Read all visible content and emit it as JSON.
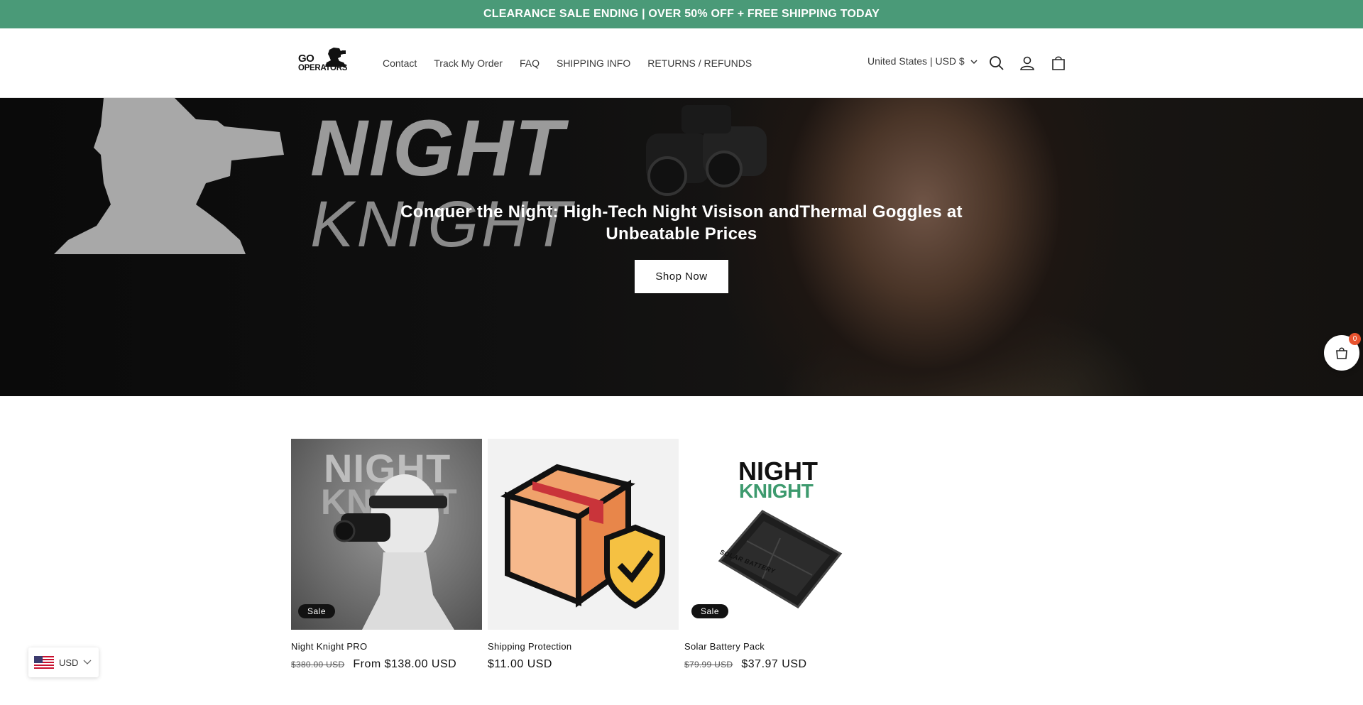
{
  "announcement": {
    "text": "CLEARANCE SALE ENDING | OVER 50% OFF + FREE SHIPPING TODAY"
  },
  "header": {
    "logo": {
      "line1": "GO",
      "line2": "OPERATORS"
    },
    "nav": [
      {
        "label": "Contact"
      },
      {
        "label": "Track My Order"
      },
      {
        "label": "FAQ"
      },
      {
        "label": "SHIPPING INFO"
      },
      {
        "label": "RETURNS / REFUNDS"
      }
    ],
    "region": "United States | USD $",
    "icons": [
      "search-icon",
      "account-icon",
      "cart-icon"
    ]
  },
  "hero": {
    "background_words": {
      "line1": "NIGHT",
      "line2": "KNIGHT"
    },
    "title": "Conquer the Night: High-Tech Night Visison andThermal Goggles at Unbeatable Prices",
    "button": "Shop Now"
  },
  "floating_cart": {
    "count": "0",
    "icon": "shopping-bag-icon"
  },
  "products": [
    {
      "title": "Night Knight PRO",
      "badge": "Sale",
      "price_old": "$380.00 USD",
      "price": "From $138.00 USD",
      "image_words": {
        "line1": "NIGHT",
        "line2": "KNIGHT"
      }
    },
    {
      "title": "Shipping Protection",
      "badge": "",
      "price_old": "",
      "price": "$11.00 USD"
    },
    {
      "title": "Solar Battery Pack",
      "badge": "Sale",
      "price_old": "$79.99 USD",
      "price": "$37.97 USD",
      "image_words": {
        "line1": "NIGHT",
        "line2": "KNIGHT",
        "device_label": "SOLAR BATTERY"
      }
    }
  ],
  "currency_widget": {
    "label": "USD",
    "flag": "us-flag-icon"
  },
  "colors": {
    "announcement_bg": "#4a9a78",
    "brand_green": "#3d9a6e",
    "sale_badge_bg": "#121212",
    "cart_badge": "#e8532f"
  }
}
